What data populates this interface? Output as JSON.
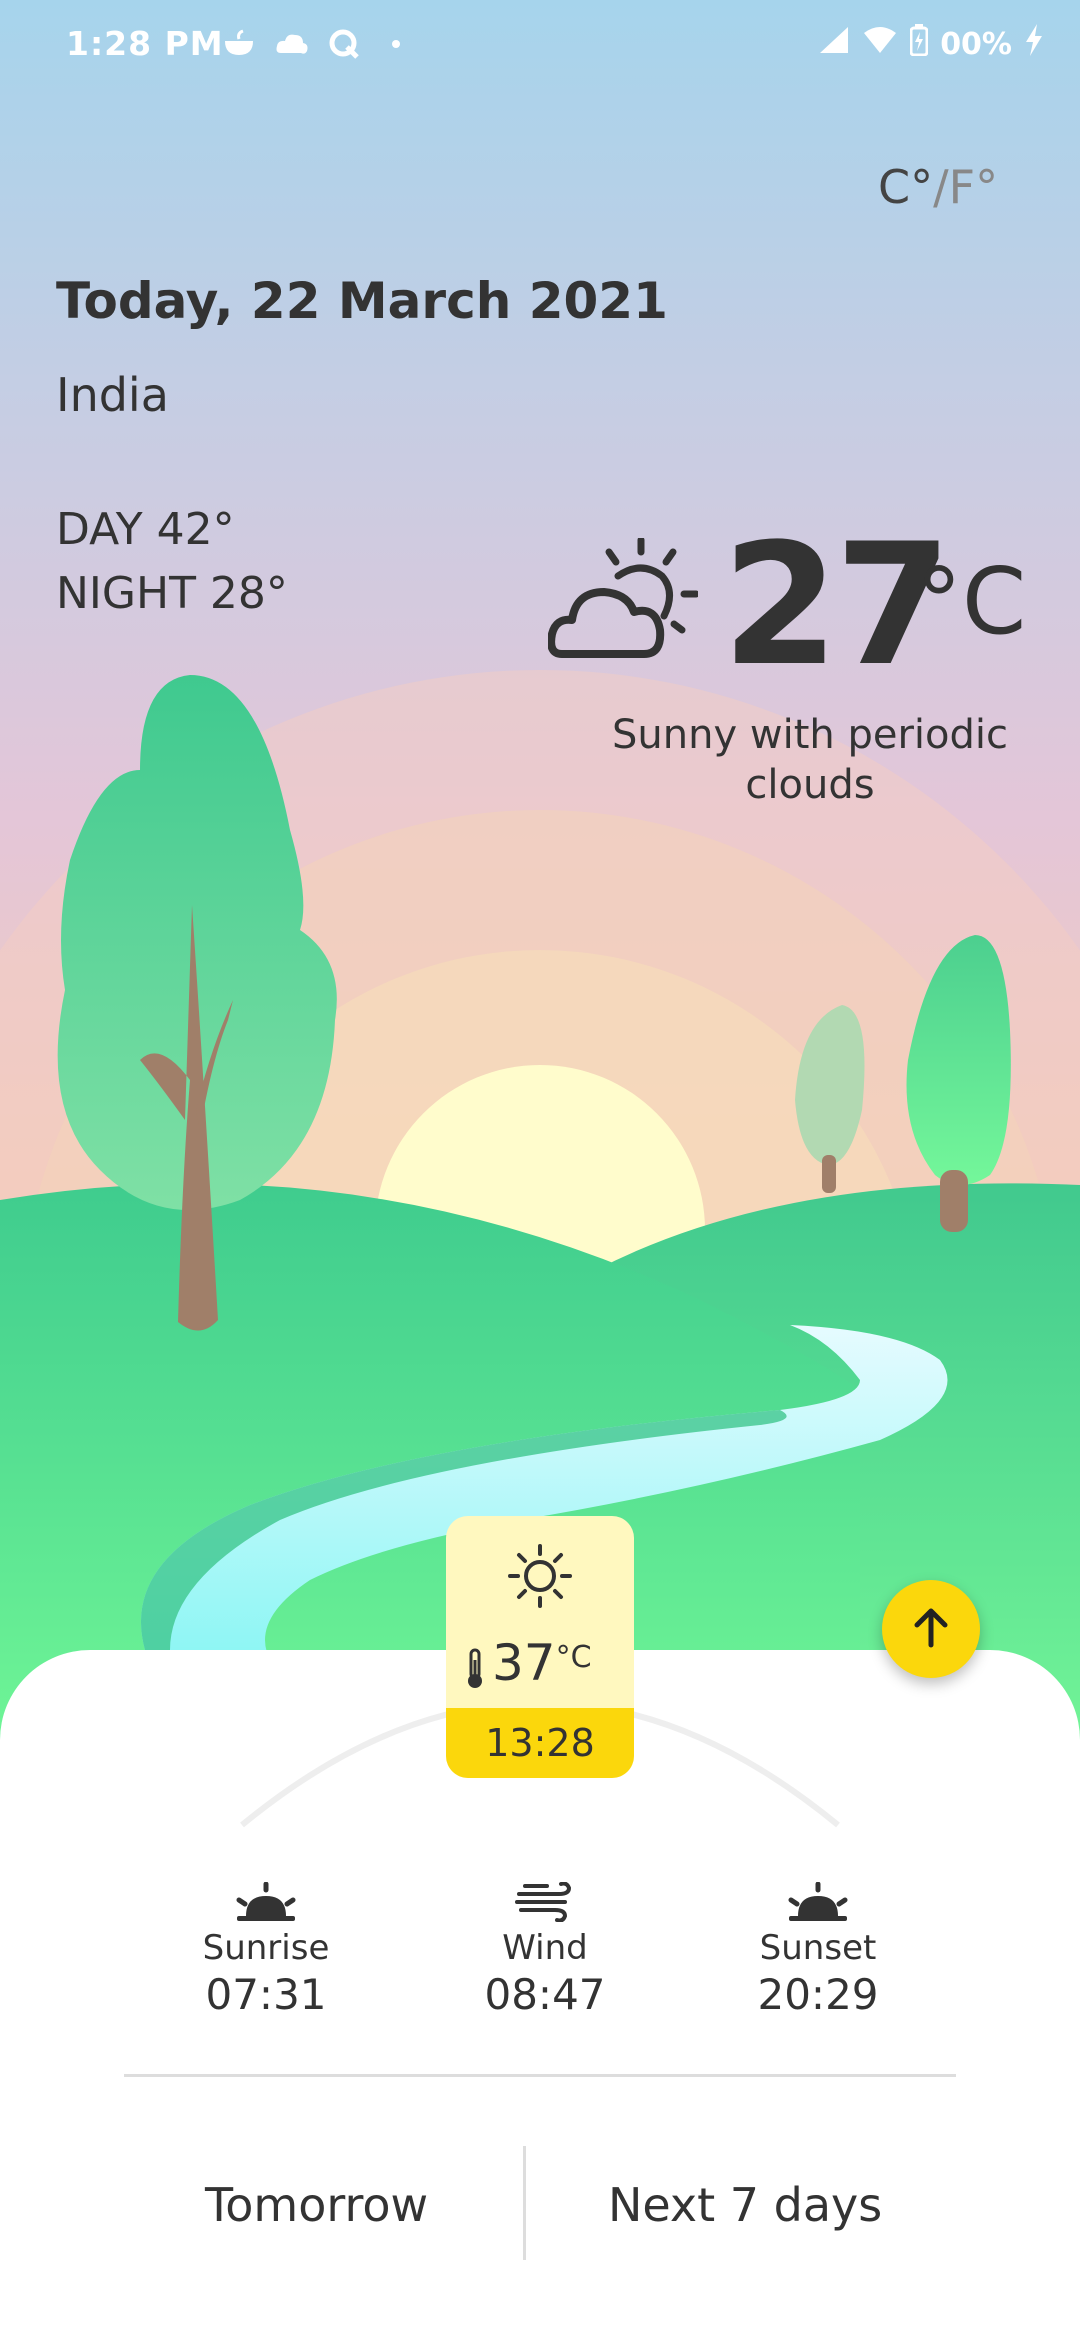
{
  "status_bar": {
    "time": "1:28 PM",
    "battery": "00%",
    "left_icons": [
      "cup-icon",
      "cloud-chat-icon",
      "q-icon",
      "dot-icon"
    ],
    "right_icons": [
      "signal-icon",
      "wifi-icon",
      "battery-icon",
      "charging-icon"
    ]
  },
  "units": {
    "celsius": "C°",
    "separator": "/",
    "fahrenheit": "F°"
  },
  "header": {
    "date": "Today, 22 March 2021",
    "location": "India",
    "day_temp": "DAY 42°",
    "night_temp": "NIGHT 28°"
  },
  "current": {
    "temp": "27",
    "unit": "°C",
    "condition": "Sunny with periodic clouds",
    "icon": "sun-cloud-icon"
  },
  "now_card": {
    "icon": "sun-icon",
    "temp": "37",
    "unit": "°C",
    "time": "13:28"
  },
  "stats": {
    "sunrise": {
      "label": "Sunrise",
      "value": "07:31",
      "icon": "sunrise-icon"
    },
    "wind": {
      "label": "Wind",
      "value": "08:47",
      "icon": "wind-icon"
    },
    "sunset": {
      "label": "Sunset",
      "value": "20:29",
      "icon": "sunset-icon"
    }
  },
  "tabs": {
    "tomorrow": "Tomorrow",
    "next7": "Next 7 days"
  },
  "colors": {
    "accent": "#fbd70c",
    "card_highlight": "#fff8bf",
    "text": "#333333"
  }
}
